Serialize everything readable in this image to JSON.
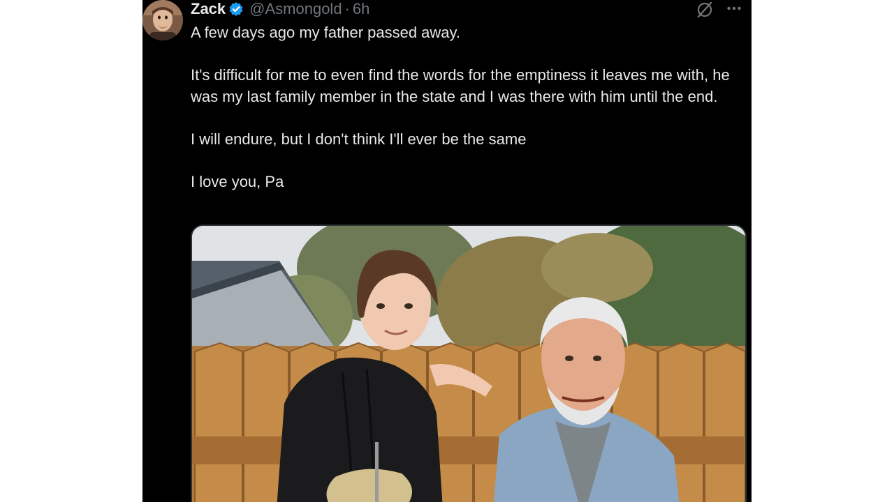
{
  "post": {
    "author_name": "Zack",
    "handle": "@Asmongold",
    "separator": "·",
    "time": "6h",
    "paragraphs": [
      "A few days ago my father passed away.",
      "It's difficult for me to even find the words for the emptiness it leaves me with, he was my last family member in the state and I was there with him until the end.",
      "I will endure, but I don't think I'll ever be the same",
      "I love you, Pa"
    ]
  },
  "icons": {
    "verified": "verified-badge-icon",
    "grok": "grok-icon",
    "more": "more-options-icon"
  },
  "colors": {
    "background": "#000000",
    "text": "#e7e9ea",
    "secondary_text": "#71767b",
    "verified_blue": "#1d9bf0"
  }
}
